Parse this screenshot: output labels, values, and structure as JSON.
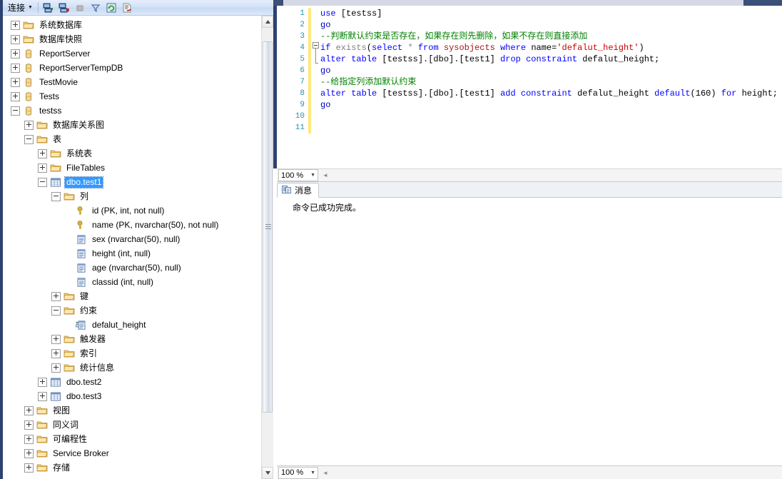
{
  "object_explorer": {
    "toolbar": {
      "connect_label": "连接",
      "buttons": [
        {
          "name": "connect-object-explorer",
          "title": "连接"
        },
        {
          "name": "disconnect-object-explorer",
          "title": "断开连接"
        },
        {
          "name": "stop",
          "title": "停止"
        },
        {
          "name": "filter",
          "title": "筛选器"
        },
        {
          "name": "refresh",
          "title": "刷新"
        },
        {
          "name": "report",
          "title": "报表"
        }
      ]
    },
    "tree": [
      {
        "label": "系统数据库",
        "indent": 1,
        "icon": "folder-icon",
        "state": "plus"
      },
      {
        "label": "数据库快照",
        "indent": 1,
        "icon": "folder-icon",
        "state": "plus"
      },
      {
        "label": "ReportServer",
        "indent": 1,
        "icon": "database-icon",
        "state": "plus"
      },
      {
        "label": "ReportServerTempDB",
        "indent": 1,
        "icon": "database-icon",
        "state": "plus"
      },
      {
        "label": "TestMovie",
        "indent": 1,
        "icon": "database-icon",
        "state": "plus"
      },
      {
        "label": "Tests",
        "indent": 1,
        "icon": "database-icon",
        "state": "plus"
      },
      {
        "label": "testss",
        "indent": 1,
        "icon": "database-icon",
        "state": "minus"
      },
      {
        "label": "数据库关系图",
        "indent": 2,
        "icon": "folder-icon",
        "state": "plus"
      },
      {
        "label": "表",
        "indent": 2,
        "icon": "folder-icon",
        "state": "minus"
      },
      {
        "label": "系统表",
        "indent": 3,
        "icon": "folder-icon",
        "state": "plus"
      },
      {
        "label": "FileTables",
        "indent": 3,
        "icon": "folder-icon",
        "state": "plus"
      },
      {
        "label": "dbo.test1",
        "indent": 3,
        "icon": "table-icon",
        "state": "minus",
        "selected": true
      },
      {
        "label": "列",
        "indent": 4,
        "icon": "folder-icon",
        "state": "minus"
      },
      {
        "label": "id (PK, int, not null)",
        "indent": 5,
        "icon": "key-icon",
        "state": "none"
      },
      {
        "label": "name (PK, nvarchar(50), not null)",
        "indent": 5,
        "icon": "key-icon",
        "state": "none"
      },
      {
        "label": "sex (nvarchar(50), null)",
        "indent": 5,
        "icon": "column-icon",
        "state": "none"
      },
      {
        "label": "height (int, null)",
        "indent": 5,
        "icon": "column-icon",
        "state": "none"
      },
      {
        "label": "age (nvarchar(50), null)",
        "indent": 5,
        "icon": "column-icon",
        "state": "none"
      },
      {
        "label": "classid (int, null)",
        "indent": 5,
        "icon": "column-icon",
        "state": "none"
      },
      {
        "label": "键",
        "indent": 4,
        "icon": "folder-icon",
        "state": "plus"
      },
      {
        "label": "约束",
        "indent": 4,
        "icon": "folder-icon",
        "state": "minus"
      },
      {
        "label": "defalut_height",
        "indent": 5,
        "icon": "constraint-icon",
        "state": "none"
      },
      {
        "label": "触发器",
        "indent": 4,
        "icon": "folder-icon",
        "state": "plus"
      },
      {
        "label": "索引",
        "indent": 4,
        "icon": "folder-icon",
        "state": "plus"
      },
      {
        "label": "统计信息",
        "indent": 4,
        "icon": "folder-icon",
        "state": "plus"
      },
      {
        "label": "dbo.test2",
        "indent": 3,
        "icon": "table-icon",
        "state": "plus"
      },
      {
        "label": "dbo.test3",
        "indent": 3,
        "icon": "table-icon",
        "state": "plus"
      },
      {
        "label": "视图",
        "indent": 2,
        "icon": "folder-icon",
        "state": "plus"
      },
      {
        "label": "同义词",
        "indent": 2,
        "icon": "folder-icon",
        "state": "plus"
      },
      {
        "label": "可编程性",
        "indent": 2,
        "icon": "folder-icon",
        "state": "plus"
      },
      {
        "label": "Service Broker",
        "indent": 2,
        "icon": "folder-icon",
        "state": "plus"
      },
      {
        "label": "存储",
        "indent": 2,
        "icon": "folder-icon",
        "state": "plus"
      }
    ]
  },
  "editor": {
    "line_numbers": [
      "1",
      "2",
      "3",
      "4",
      "5",
      "6",
      "7",
      "8",
      "9",
      "10",
      "11"
    ],
    "code_lines": [
      [
        {
          "t": "use ",
          "c": "kw"
        },
        {
          "t": "[testss]",
          "c": "plain"
        }
      ],
      [
        {
          "t": "go",
          "c": "kwblue"
        }
      ],
      [
        {
          "t": "--判断默认约束是否存在，如果存在则先删除，如果不存在则直接添加",
          "c": "com"
        }
      ],
      [
        {
          "t": "if ",
          "c": "kw"
        },
        {
          "t": "exists",
          "c": "fn"
        },
        {
          "t": "(",
          "c": "plain"
        },
        {
          "t": "select ",
          "c": "kw"
        },
        {
          "t": "* ",
          "c": "fn"
        },
        {
          "t": "from ",
          "c": "kw"
        },
        {
          "t": "sysobjects ",
          "c": "sys"
        },
        {
          "t": "where ",
          "c": "kw"
        },
        {
          "t": "name=",
          "c": "plain"
        },
        {
          "t": "'defalut_height'",
          "c": "str"
        },
        {
          "t": ")",
          "c": "plain"
        }
      ],
      [
        {
          "t": "alter table ",
          "c": "kw"
        },
        {
          "t": "[testss].[dbo].[test1] ",
          "c": "plain"
        },
        {
          "t": "drop constraint ",
          "c": "kw"
        },
        {
          "t": "defalut_height",
          "c": "plain"
        },
        {
          "t": ";",
          "c": "plain"
        }
      ],
      [
        {
          "t": "go",
          "c": "kwblue"
        }
      ],
      [
        {
          "t": "--给指定列添加默认约束",
          "c": "com"
        }
      ],
      [
        {
          "t": "alter table ",
          "c": "kw"
        },
        {
          "t": "[testss].[dbo].[test1] ",
          "c": "plain"
        },
        {
          "t": "add constraint ",
          "c": "kw"
        },
        {
          "t": "defalut_height ",
          "c": "plain"
        },
        {
          "t": "default",
          "c": "kw"
        },
        {
          "t": "(",
          "c": "plain"
        },
        {
          "t": "160",
          "c": "num"
        },
        {
          "t": ") ",
          "c": "plain"
        },
        {
          "t": "for ",
          "c": "kw"
        },
        {
          "t": "height",
          "c": "plain"
        },
        {
          "t": ";",
          "c": "plain"
        }
      ],
      [
        {
          "t": "go",
          "c": "kwblue"
        }
      ],
      [],
      []
    ],
    "zoom_level": "100 %",
    "zoom_level_bottom": "100 %"
  },
  "results": {
    "tab_label": "消息",
    "tab_icon": "messages-icon",
    "message": "命令已成功完成。"
  },
  "colors": {
    "selection": "#3399ff",
    "window_border": "#2e4270",
    "change_bar": "#ffe87c",
    "keyword": "#0000ff",
    "comment": "#008000",
    "string": "#cc0000",
    "system_table": "#a31515",
    "line_number": "#2b91af"
  }
}
